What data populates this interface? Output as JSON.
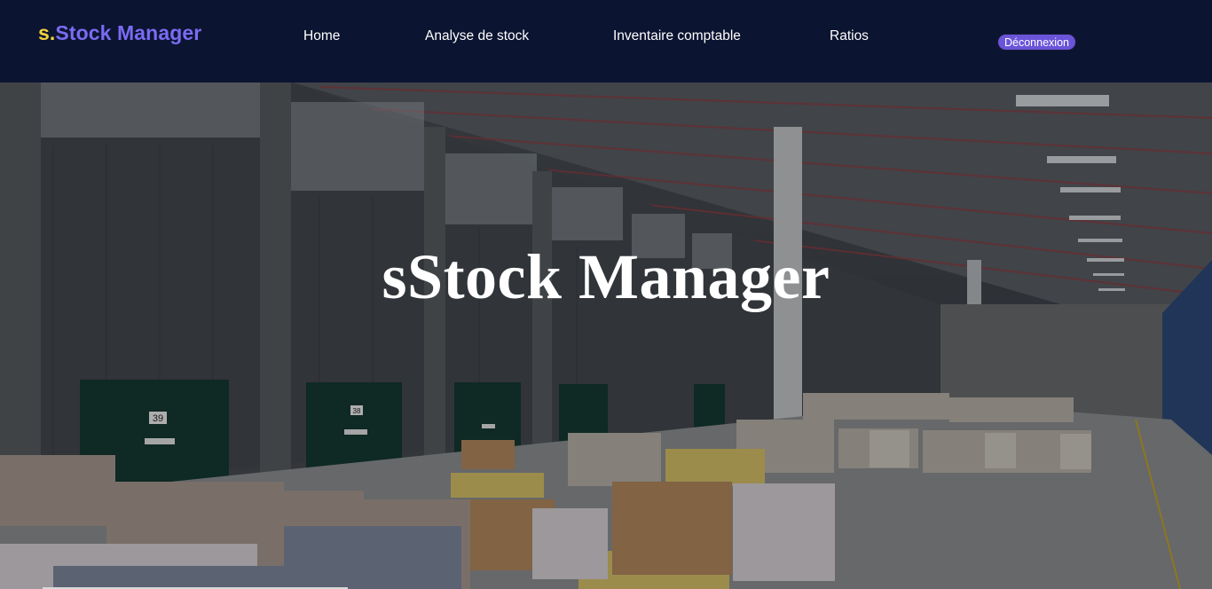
{
  "header": {
    "brand_prefix": "s.",
    "brand_name": "Stock Manager",
    "nav": {
      "home": "Home",
      "analyse": "Analyse de stock",
      "inventaire": "Inventaire comptable",
      "ratios": "Ratios"
    },
    "logout_label": "Déconnexion"
  },
  "hero": {
    "title": "sStock Manager",
    "image_description_icon": "warehouse-photo",
    "door_numbers": [
      "39",
      "38"
    ]
  },
  "colors": {
    "navbar_bg": "#0b1430",
    "brand_accent": "#7a6bf2",
    "brand_prefix": "#f3d23c",
    "logout_bg": "#6a54d9"
  }
}
